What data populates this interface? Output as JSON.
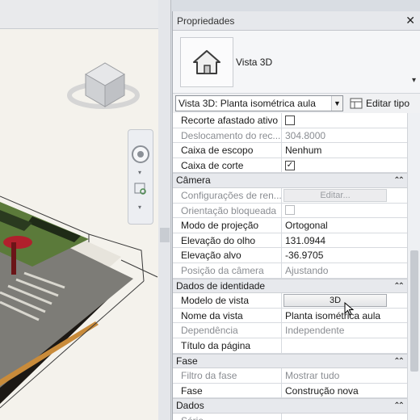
{
  "panel": {
    "title": "Propriedades",
    "type_label": "Vista 3D",
    "selector_value": "Vista 3D: Planta isométrica aula",
    "edit_type_label": "Editar tipo"
  },
  "properties": [
    {
      "kind": "row",
      "label": "Recorte afastado ativo",
      "checkbox": true,
      "checked": false
    },
    {
      "kind": "row",
      "label": "Deslocamento do rec...",
      "value": "304.8000",
      "disabled": true
    },
    {
      "kind": "row",
      "label": "Caixa de escopo",
      "value": "Nenhum"
    },
    {
      "kind": "row",
      "label": "Caixa de corte",
      "checkbox": true,
      "checked": true
    },
    {
      "kind": "section",
      "label": "Câmera"
    },
    {
      "kind": "row",
      "label": "Configurações de ren...",
      "button": "Editar...",
      "disabled": true
    },
    {
      "kind": "row",
      "label": "Orientação bloqueada",
      "checkbox": true,
      "checked": false,
      "disabled": true
    },
    {
      "kind": "row",
      "label": "Modo de projeção",
      "value": "Ortogonal"
    },
    {
      "kind": "row",
      "label": "Elevação do olho",
      "value": "131.0944"
    },
    {
      "kind": "row",
      "label": "Elevação alvo",
      "value": "-36.9705"
    },
    {
      "kind": "row",
      "label": "Posição da câmera",
      "value": "Ajustando",
      "disabled": true
    },
    {
      "kind": "section",
      "label": "Dados de identidade"
    },
    {
      "kind": "row",
      "label": "Modelo de vista",
      "button": "3D"
    },
    {
      "kind": "row",
      "label": "Nome da vista",
      "value": "Planta isométrica aula"
    },
    {
      "kind": "row",
      "label": "Dependência",
      "value": "Independente",
      "disabled": true
    },
    {
      "kind": "row",
      "label": "Título da página",
      "value": ""
    },
    {
      "kind": "section",
      "label": "Fase"
    },
    {
      "kind": "row",
      "label": "Filtro da fase",
      "value": "Mostrar tudo",
      "disabled": true
    },
    {
      "kind": "row",
      "label": "Fase",
      "value": "Construção nova"
    },
    {
      "kind": "section",
      "label": "Dados"
    },
    {
      "kind": "row",
      "label": "Série",
      "value": "",
      "disabled": true
    }
  ]
}
